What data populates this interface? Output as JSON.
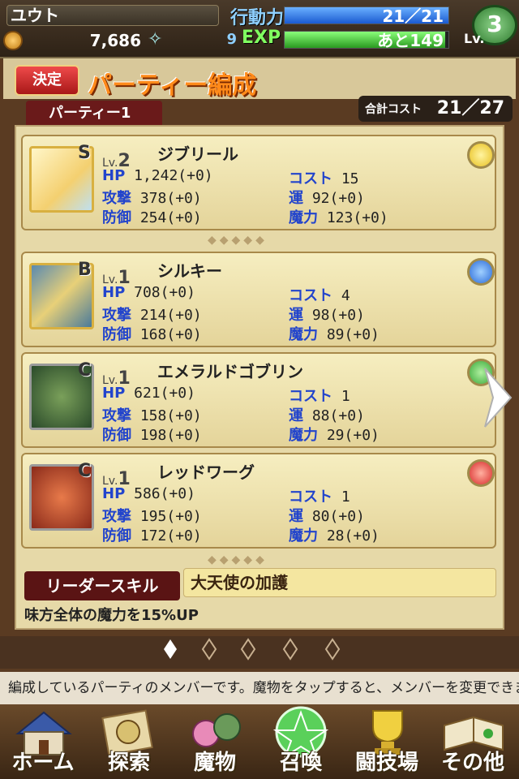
{
  "status": {
    "player_name": "ユウト",
    "gold": "7,686",
    "stamina_label": "行動力",
    "stamina_value": "21／21",
    "stamina_fraction": 1.0,
    "exp_level": "9",
    "exp_label": "EXP",
    "exp_remaining": "あと149",
    "exp_fraction": 0.98,
    "player_level": "3",
    "level_label": "Lv."
  },
  "header": {
    "decide_label": "決定",
    "title": "パーティー編成",
    "party_tab": "パーティー1",
    "cost_label": "合計コスト",
    "cost_value": "21／27"
  },
  "labels": {
    "hp": "HP",
    "atk": "攻撃",
    "def": "防御",
    "cost": "コスト",
    "luck": "運",
    "mag": "魔力",
    "lv": "Lv."
  },
  "monsters": [
    {
      "rank": "S",
      "level": "2",
      "name": "ジブリール",
      "hp": "1,242(+0)",
      "atk": "378(+0)",
      "def": "254(+0)",
      "cost": "15",
      "luck": "92(+0)",
      "mag": "123(+0)",
      "element": "light",
      "element_color": "#e8c020"
    },
    {
      "rank": "B",
      "level": "1",
      "name": "シルキー",
      "hp": "708(+0)",
      "atk": "214(+0)",
      "def": "168(+0)",
      "cost": "4",
      "luck": "98(+0)",
      "mag": "89(+0)",
      "element": "water",
      "element_color": "#2a6ad8"
    },
    {
      "rank": "C",
      "level": "1",
      "name": "エメラルドゴブリン",
      "hp": "621(+0)",
      "atk": "158(+0)",
      "def": "198(+0)",
      "cost": "1",
      "luck": "88(+0)",
      "mag": "29(+0)",
      "element": "wind",
      "element_color": "#3aa83a"
    },
    {
      "rank": "C",
      "level": "1",
      "name": "レッドワーグ",
      "hp": "586(+0)",
      "atk": "195(+0)",
      "def": "172(+0)",
      "cost": "1",
      "luck": "80(+0)",
      "mag": "28(+0)",
      "element": "fire",
      "element_color": "#d82a2a"
    }
  ],
  "leader": {
    "label": "リーダースキル",
    "skill_name": "大天使の加護",
    "description": "味方全体の魔力を15%UP"
  },
  "hint": "編成しているパーティのメンバーです。魔物をタップすると、メンバーを変更できます",
  "nav": [
    {
      "label": "ホーム",
      "icon": "house-icon"
    },
    {
      "label": "探索",
      "icon": "compass-icon"
    },
    {
      "label": "魔物",
      "icon": "monster-icon"
    },
    {
      "label": "召喚",
      "icon": "pentagram-icon"
    },
    {
      "label": "闘技場",
      "icon": "trophy-icon"
    },
    {
      "label": "その他",
      "icon": "book-icon"
    }
  ]
}
